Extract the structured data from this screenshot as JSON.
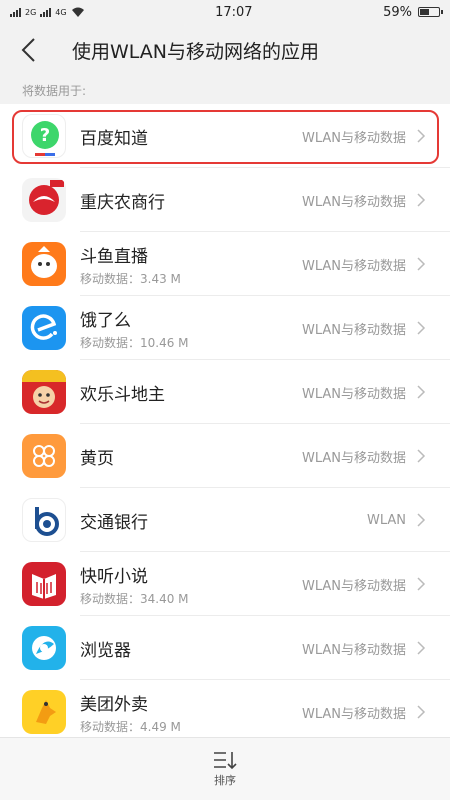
{
  "status_bar": {
    "network_1": "2G",
    "network_2": "4G",
    "time": "17:07",
    "battery": "59%",
    "battery_level": 0.59
  },
  "header": {
    "title": "使用WLAN与移动网络的应用"
  },
  "section_label": "将数据用于:",
  "apps": [
    {
      "name": "百度知道",
      "sub": "",
      "mode": "WLAN与移动数据",
      "icon": "baidu-zhidao-icon"
    },
    {
      "name": "重庆农商行",
      "sub": "",
      "mode": "WLAN与移动数据",
      "icon": "cq-rural-bank-icon"
    },
    {
      "name": "斗鱼直播",
      "sub": "移动数据：3.43 M",
      "mode": "WLAN与移动数据",
      "icon": "douyu-icon"
    },
    {
      "name": "饿了么",
      "sub": "移动数据：10.46 M",
      "mode": "WLAN与移动数据",
      "icon": "eleme-icon"
    },
    {
      "name": "欢乐斗地主",
      "sub": "",
      "mode": "WLAN与移动数据",
      "icon": "doudizhu-icon"
    },
    {
      "name": "黄页",
      "sub": "",
      "mode": "WLAN与移动数据",
      "icon": "yellow-pages-icon"
    },
    {
      "name": "交通银行",
      "sub": "",
      "mode": "WLAN",
      "icon": "bocom-icon"
    },
    {
      "name": "快听小说",
      "sub": "移动数据：34.40 M",
      "mode": "WLAN与移动数据",
      "icon": "kuaiting-icon"
    },
    {
      "name": "浏览器",
      "sub": "",
      "mode": "WLAN与移动数据",
      "icon": "browser-icon"
    },
    {
      "name": "美团外卖",
      "sub": "移动数据：4.49 M",
      "mode": "WLAN与移动数据",
      "icon": "meituan-waimai-icon"
    }
  ],
  "bottom_bar": {
    "sort_label": "排序",
    "icon": "sort-icon"
  },
  "colors": {
    "highlight": "#e53935",
    "muted_text": "#999999"
  }
}
